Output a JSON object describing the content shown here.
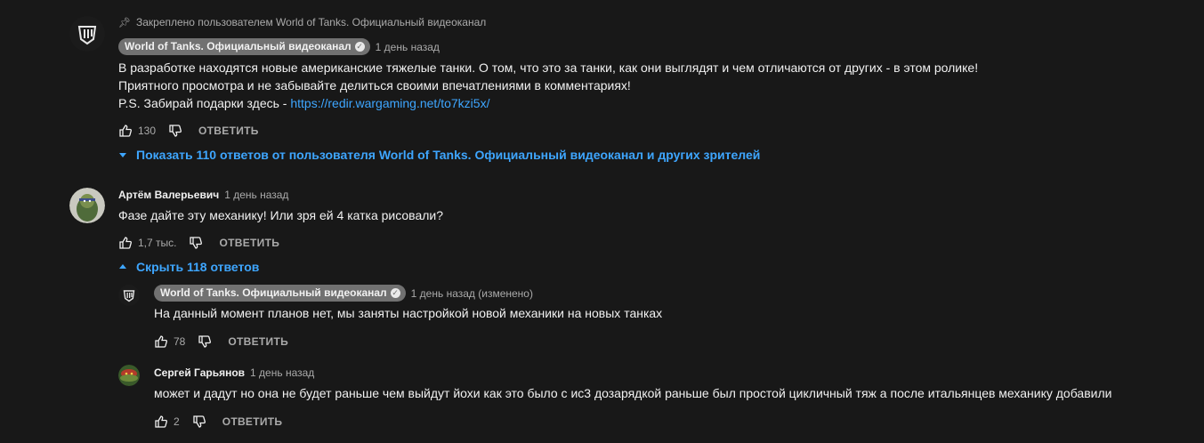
{
  "comments": [
    {
      "pinned_label": "Закреплено пользователем World of Tanks. Официальный видеоканал",
      "author": "World of Tanks. Официальный видеоканал",
      "time": "1 день назад",
      "lines": [
        "В разработке находятся новые американские тяжелые танки. О том, что это за танки, как они выглядят и чем отличаются от других - в этом ролике!",
        "Приятного просмотра и не забывайте делиться своими впечатлениями в комментариях!"
      ],
      "ps_text": "P.S. Забирай подарки здесь - ",
      "ps_link": "https://redir.wargaming.net/to7kzi5x/",
      "likes": "130",
      "reply_label": "ОТВЕТИТЬ",
      "replies_toggle": "Показать 110 ответов от пользователя World of Tanks. Официальный видеоканал и других зрителей"
    },
    {
      "author": "Артём Валерьевич",
      "time": "1 день назад",
      "text": "Фазе дайте эту механику! Или зря ей 4 катка рисовали?",
      "likes": "1,7 тыс.",
      "reply_label": "ОТВЕТИТЬ",
      "replies_toggle": "Скрыть 118 ответов"
    }
  ],
  "replies": [
    {
      "author": "World of Tanks. Официальный видеоканал",
      "time": "1 день назад (изменено)",
      "text": "На данный момент планов нет, мы заняты настройкой новой механики на новых танках",
      "likes": "78",
      "reply_label": "ОТВЕТИТЬ"
    },
    {
      "author": "Сергей Гарьянов",
      "time": "1 день назад",
      "text": "может и дадут но она не будет раньше чем выйдут йохи как это было с ис3 дозарядкой раньше был простой цикличный тяж а после итальянцев механику добавили",
      "likes": "2",
      "reply_label": "ОТВЕТИТЬ"
    }
  ],
  "icons": {
    "pin": "pin-icon",
    "like": "thumb-up-icon",
    "dislike": "thumb-down-icon",
    "expand": "caret-down-icon",
    "collapse": "caret-up-icon",
    "verified": "verified-check-icon"
  },
  "colors": {
    "background": "#181818",
    "link": "#3ea6ff",
    "channel_chip": "#717171",
    "secondary_text": "#aaaaaa"
  }
}
